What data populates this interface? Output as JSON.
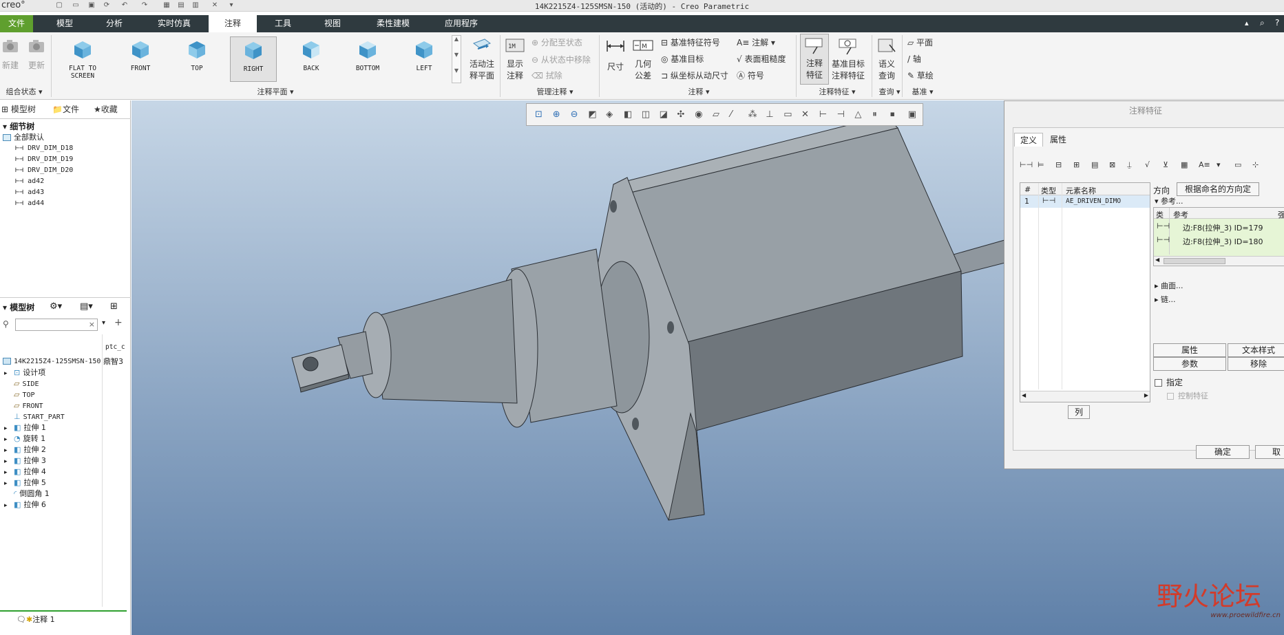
{
  "app": {
    "logo": "creo°",
    "window_title": "14K2215Z4-125SMSN-150 (活动的) - Creo Parametric"
  },
  "menu": {
    "tabs": [
      "文件",
      "模型",
      "分析",
      "实时仿真",
      "注释",
      "工具",
      "视图",
      "柔性建模",
      "应用程序"
    ],
    "active": "注释"
  },
  "ribbon": {
    "groups": {
      "combo_state": "组合状态",
      "annotation_plane": "注释平面",
      "manage_annotation": "管理注释",
      "annotation": "注释",
      "annotation_feature": "注释特征",
      "query": "查询",
      "datum": "基准"
    },
    "combo_state": {
      "new": "新建",
      "update": "更新"
    },
    "views": [
      {
        "label1": "FLAT TO",
        "label2": "SCREEN"
      },
      {
        "label1": "FRONT",
        "label2": ""
      },
      {
        "label1": "TOP",
        "label2": ""
      },
      {
        "label1": "RIGHT",
        "label2": ""
      },
      {
        "label1": "BACK",
        "label2": ""
      },
      {
        "label1": "BOTTOM",
        "label2": ""
      },
      {
        "label1": "LEFT",
        "label2": ""
      }
    ],
    "selected_view": "RIGHT",
    "active_plane": {
      "line1": "活动注",
      "line2": "释平面"
    },
    "manage": {
      "show": {
        "line1": "显示",
        "line2": "注释"
      },
      "assign_state": "分配至状态",
      "remove_from_state": "从状态中移除",
      "erase": "拭除"
    },
    "annotation": {
      "dimension": "尺寸",
      "geom_tol": {
        "line1": "几何",
        "line2": "公差"
      },
      "datum_feature_symbol": "基准特征符号",
      "datum_target": "基准目标",
      "ordinate_driven_dim": "纵坐标从动尺寸",
      "note": "注解",
      "surface_finish": "表面粗糙度",
      "symbol": "符号"
    },
    "annotation_feature": {
      "note_feature": {
        "line1": "注释",
        "line2": "特征"
      },
      "datum_target_feature": {
        "line1": "基准目标",
        "line2": "注释特征"
      }
    },
    "query": {
      "semantic": {
        "line1": "语义",
        "line2": "查询"
      }
    },
    "datum": {
      "plane": "平面",
      "axis": "轴",
      "sketch": "草绘"
    }
  },
  "left_panel": {
    "tabs": [
      "模型树",
      "文件",
      "收藏"
    ],
    "detail_tree": {
      "title": "细节树",
      "root": "全部默认",
      "items": [
        "DRV_DIM_D18",
        "DRV_DIM_D19",
        "DRV_DIM_D20",
        "ad42",
        "ad43",
        "ad44"
      ]
    },
    "model_tree": {
      "title": "模型树",
      "column_header": "ptc_c",
      "root": {
        "name": "14K2215Z4-125SMSN-150",
        "col": "鼎智3"
      },
      "items": [
        {
          "name": "设计项",
          "type": "design"
        },
        {
          "name": "SIDE",
          "type": "plane"
        },
        {
          "name": "TOP",
          "type": "plane"
        },
        {
          "name": "FRONT",
          "type": "plane"
        },
        {
          "name": "START_PART",
          "type": "csys"
        },
        {
          "name": "拉伸 1",
          "type": "extrude"
        },
        {
          "name": "旋转 1",
          "type": "revolve"
        },
        {
          "name": "拉伸 2",
          "type": "extrude"
        },
        {
          "name": "拉伸 3",
          "type": "extrude"
        },
        {
          "name": "拉伸 4",
          "type": "extrude"
        },
        {
          "name": "拉伸 5",
          "type": "extrude"
        },
        {
          "name": "倒圆角 1",
          "type": "round"
        },
        {
          "name": "拉伸 6",
          "type": "extrude"
        }
      ],
      "insert_item": "注释 1"
    }
  },
  "dialog": {
    "title": "注释特征",
    "tabs": [
      "定义",
      "属性"
    ],
    "active_tab": "定义",
    "table": {
      "headers": [
        "#",
        "类型",
        "元素名称"
      ],
      "rows": [
        {
          "num": "1",
          "name": "AE_DRIVEN_DIMO"
        }
      ]
    },
    "column_button": "列",
    "orientation_label": "方向",
    "orientation_value": "根据命名的方向定",
    "references_label": "参考...",
    "ref_table": {
      "headers": [
        "类",
        "参考",
        "强"
      ],
      "rows": [
        "边:F8(拉伸_3) ID=179",
        "边:F8(拉伸_3) ID=180"
      ]
    },
    "surfaces": "曲面...",
    "chains": "链...",
    "buttons": {
      "properties": "属性",
      "text_style": "文本样式",
      "params": "参数",
      "move": "移除"
    },
    "specify": "指定",
    "control_feature": "控制特征",
    "ok": "确定",
    "cancel": "取消"
  },
  "watermark": {
    "text": "野火论坛",
    "url": "www.proewildfire.cn"
  }
}
